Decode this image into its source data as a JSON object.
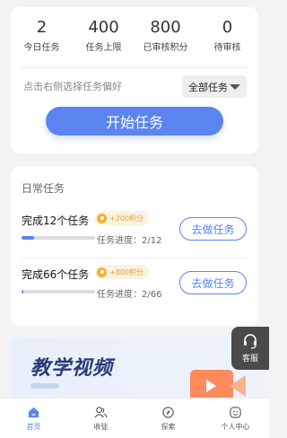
{
  "stats": [
    {
      "value": "2",
      "label": "今日任务"
    },
    {
      "value": "400",
      "label": "任务上限"
    },
    {
      "value": "800",
      "label": "已审核积分"
    },
    {
      "value": "0",
      "label": "待审核"
    }
  ],
  "preference": {
    "hint": "点击右侧选择任务偏好",
    "selected": "全部任务"
  },
  "start_button": "开始任务",
  "daily": {
    "title": "日常任务",
    "tasks": [
      {
        "name": "完成12个任务",
        "reward": "+200积分",
        "progress_label": "任务进度：2/12",
        "progress": 0.167,
        "action": "去做任务"
      },
      {
        "name": "完成66个任务",
        "reward": "+800积分",
        "progress_label": "任务进度：2/66",
        "progress": 0.03,
        "action": "去做任务"
      }
    ]
  },
  "banner": {
    "title": "教学视频"
  },
  "service": {
    "label": "客服"
  },
  "tabs": [
    {
      "label": "首页",
      "icon": "home-icon",
      "active": true
    },
    {
      "label": "收徒",
      "icon": "users-icon",
      "active": false
    },
    {
      "label": "探索",
      "icon": "explore-icon",
      "active": false
    },
    {
      "label": "个人中心",
      "icon": "profile-icon",
      "active": false
    }
  ],
  "colors": {
    "accent": "#5b84f0",
    "reward": "#e2a03a",
    "service_bg": "#4a4a4a"
  }
}
